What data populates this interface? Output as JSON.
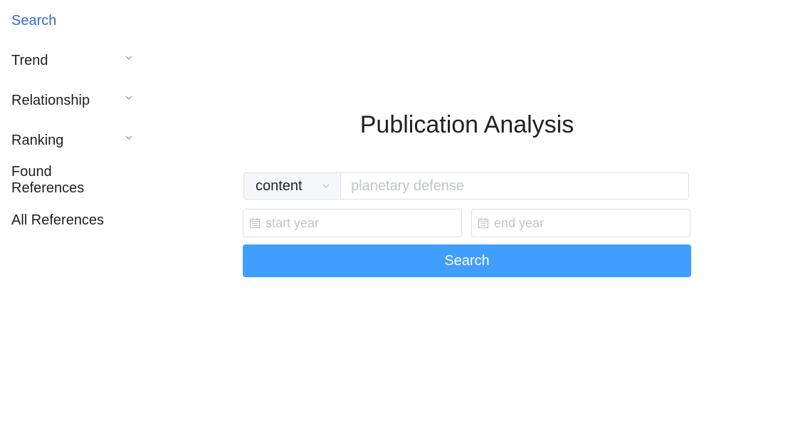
{
  "sidebar": {
    "items": [
      {
        "label": "Search",
        "active": true,
        "expandable": false
      },
      {
        "label": "Trend",
        "active": false,
        "expandable": true
      },
      {
        "label": "Relationship",
        "active": false,
        "expandable": true
      },
      {
        "label": "Ranking",
        "active": false,
        "expandable": true
      },
      {
        "label": "Found References",
        "active": false,
        "expandable": false
      },
      {
        "label": "All References",
        "active": false,
        "expandable": false
      }
    ],
    "active_color": "#3a67d6"
  },
  "main": {
    "title": "Publication Analysis",
    "field_select": {
      "value": "content"
    },
    "query": {
      "placeholder": "planetary defense",
      "value": ""
    },
    "start_year": {
      "placeholder": "start year"
    },
    "end_year": {
      "placeholder": "end year"
    },
    "search_button": {
      "label": "Search",
      "color": "#409eff"
    }
  }
}
